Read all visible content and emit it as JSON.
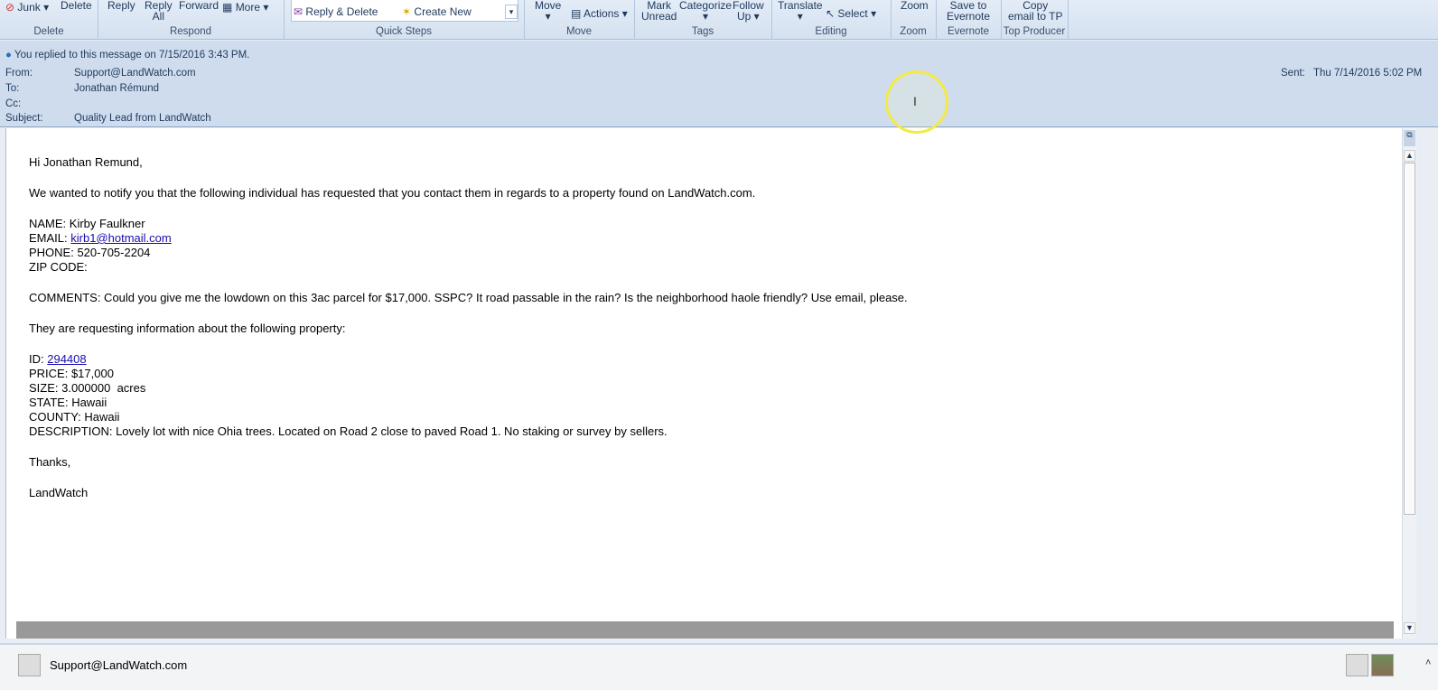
{
  "ribbon": {
    "junk": "Junk",
    "delete": "Delete",
    "reply": "Reply",
    "reply_all_1": "Reply",
    "reply_all_2": "All",
    "forward": "Forward",
    "more": "More",
    "reply_delete": "Reply & Delete",
    "create_new": "Create New",
    "move": "Move",
    "actions": "Actions",
    "mark_unread_1": "Mark",
    "mark_unread_2": "Unread",
    "categorize": "Categorize",
    "follow_up_1": "Follow",
    "follow_up_2": "Up",
    "translate": "Translate",
    "select": "Select",
    "zoom": "Zoom",
    "evernote_1": "Save to",
    "evernote_2": "Evernote",
    "copy_tp_1": "Copy",
    "copy_tp_2": "email to TP",
    "groups": {
      "delete": "Delete",
      "respond": "Respond",
      "quick_steps": "Quick Steps",
      "move": "Move",
      "tags": "Tags",
      "editing": "Editing",
      "zoom": "Zoom",
      "evernote": "Evernote",
      "top_producer": "Top Producer"
    }
  },
  "header": {
    "info": "You replied to this message on 7/15/2016 3:43 PM.",
    "from_label": "From:",
    "from": "Support@LandWatch.com",
    "to_label": "To:",
    "to": "Jonathan Rémund",
    "cc_label": "Cc:",
    "cc": "",
    "subject_label": "Subject:",
    "subject": "Quality Lead from LandWatch",
    "sent_label": "Sent:",
    "sent": "Thu 7/14/2016 5:02 PM"
  },
  "message": {
    "greeting": "Hi Jonathan Remund,",
    "intro": "We wanted to notify you that the following individual has requested that you contact them in regards to a property found on LandWatch.com.",
    "name": "NAME: Kirby Faulkner",
    "email_label": "EMAIL: ",
    "email": "kirb1@hotmail.com",
    "phone": "PHONE: 520-705-2204",
    "zip": "ZIP CODE:",
    "comments": "COMMENTS: Could you give me the lowdown on this 3ac parcel for $17,000. SSPC? It road passable in the rain? Is the neighborhood haole friendly? Use email, please.",
    "request": "They are requesting information about the following property:",
    "id_label": "ID: ",
    "id": "294408",
    "price": "PRICE: $17,000",
    "size": "SIZE: 3.000000  acres",
    "state": "STATE: Hawaii",
    "county": "COUNTY: Hawaii",
    "description": "DESCRIPTION: Lovely lot with nice Ohia trees. Located on Road 2 close to paved Road 1. No staking or survey by sellers.",
    "thanks": "Thanks,",
    "signature": "LandWatch"
  },
  "people_pane": {
    "contact": "Support@LandWatch.com"
  }
}
